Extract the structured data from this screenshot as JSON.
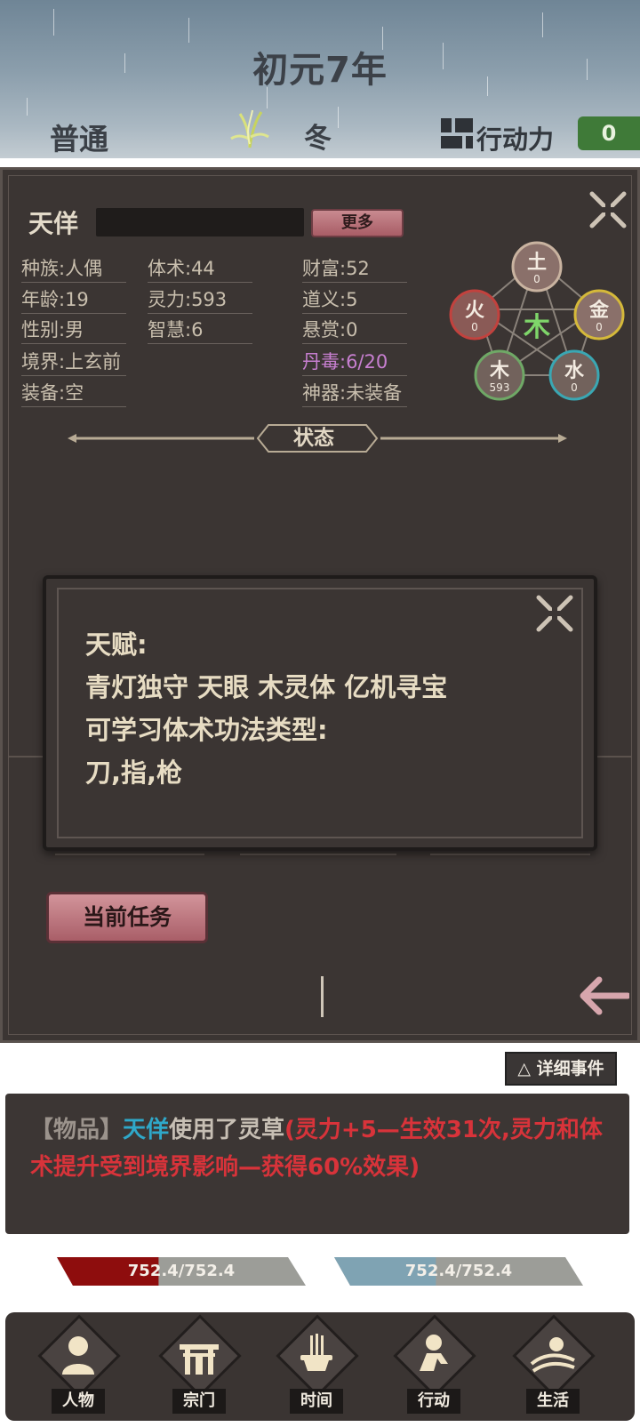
{
  "header": {
    "year": "初元7年",
    "difficulty": "普通",
    "season": "冬",
    "action_points_label": "行动力",
    "action_points_value": "0"
  },
  "character": {
    "name": "天佯",
    "more_button": "更多",
    "stats": {
      "race": "种族:人偶",
      "body_art": "体术:44",
      "wealth": "财富:52",
      "age": "年龄:19",
      "spirit": "灵力:593",
      "morality": "道义:5",
      "gender": "性别:男",
      "wisdom": "智慧:6",
      "bounty": "悬赏:0",
      "realm": "境界:上玄前",
      "pill_poison": "丹毒:6/20",
      "equipment": "装备:空",
      "artifact": "神器:未装备"
    },
    "elements": {
      "center": "木",
      "earth": {
        "label": "土",
        "value": "0",
        "color": "#c9b3a0"
      },
      "metal": {
        "label": "金",
        "value": "0",
        "color": "#d5b93a"
      },
      "water": {
        "label": "水",
        "value": "0",
        "color": "#3aa7b3"
      },
      "wood": {
        "label": "木",
        "value": "593",
        "color": "#6fa866"
      },
      "fire": {
        "label": "火",
        "value": "0",
        "color": "#c2423e"
      }
    },
    "status_label": "状态"
  },
  "talent_popup": {
    "line1": "天赋:",
    "line2": "青灯独守  天眼  木灵体  亿机寻宝",
    "line3": "可学习体术功法类型:",
    "line4": "刀,指,枪"
  },
  "task_button": "当前任务",
  "events": {
    "detail_button": "△ 详细事件",
    "tag": "【物品】",
    "actor": "天佯",
    "action": "使用了灵草",
    "effect": "(灵力+5—生效31次,灵力和体术提升受到境界影响—获得60%效果)"
  },
  "bars": {
    "hp": {
      "text": "752.4/752.4",
      "fill": 1.0,
      "color": "#8e0d0d"
    },
    "mp": {
      "text": "752.4/752.4",
      "fill": 1.0,
      "color": "#7fa3b3"
    }
  },
  "nav": [
    {
      "label": "人物",
      "icon": "person-icon"
    },
    {
      "label": "宗门",
      "icon": "gate-icon"
    },
    {
      "label": "时间",
      "icon": "incense-icon"
    },
    {
      "label": "行动",
      "icon": "action-icon"
    },
    {
      "label": "生活",
      "icon": "life-icon"
    }
  ]
}
